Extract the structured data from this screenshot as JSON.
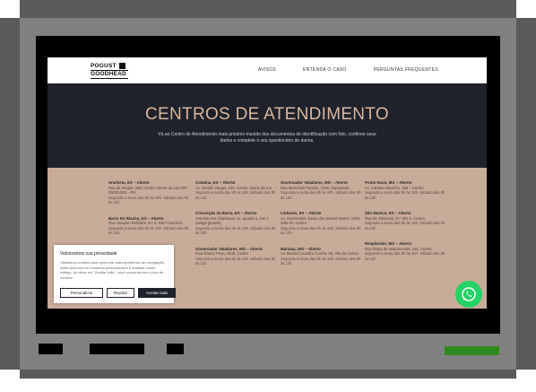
{
  "logo": {
    "line1": "POGUST",
    "line2": "GOODHEAD"
  },
  "nav": {
    "links": [
      "AVISOS",
      "ENTENDA O CASO",
      "PERGUNTAS FREQUENTES"
    ]
  },
  "hero": {
    "title": "CENTROS DE ATENDIMENTO",
    "subtitle": "Vá ao Centro de Atendimento mais próximo munido dos documentos de identificação com foto, confirme seus dados e complete o seu questionário de danos."
  },
  "centers": {
    "col1": [
      {
        "city": "Anchieta, ES – Aberto",
        "addr": "Rua da Alegria, 285, Centro, Nome da rua CEP 29230-000 – ES",
        "hours": "Segunda a sexta das 8h às 18h. Sábado das 8h às 12h"
      },
      {
        "city": "Barra Do Riacho, ES – Aberto",
        "addr": "Rua Joaquim Belizário, N.º 0, São Francisco",
        "hours": "Segunda a sexta das 8h às 18h. Sábado das 8h às 12h"
      }
    ],
    "col2": [
      {
        "city": "Colatina, ES – Aberto",
        "addr": "Av. Getúlio Vargas, 230, Centro, Nome da rua",
        "hours": "Segunda a sexta das 8h às 18h. Sábado das 8h às 12h"
      },
      {
        "city": "Conceição da Barra, ES – Aberto",
        "addr": "Avenida Ana Charleaux, 11, quadra 1, lote 1 (antigo ginásio)",
        "hours": "Segunda a sexta das 8h às 18h. Sábado das 8h às 12h"
      },
      {
        "city": "Governador Valadares, MG – Aberto",
        "addr": "Rua Afonso Pena, 2540, Centro",
        "hours": "Segunda a sexta das 8h às 18h. Sábado das 8h às 12h"
      }
    ],
    "col3": [
      {
        "city": "Governador Valadares, MG – Aberto",
        "addr": "Rua Marechal Floriano, 1055, Esplanada",
        "hours": "Segunda a sexta das 8h às 18h. Sábado das 8h às 12h"
      },
      {
        "city": "Linhares, ES – Aberto",
        "addr": "Av. Governador Jones dos Santos Neves, 1000, Sala 01, Centro",
        "hours": "Segunda a sexta das 8h às 18h. Sábado das 8h às 12h"
      },
      {
        "city": "Mariana, MG – Aberto",
        "addr": "Av. Manoel Leandro Corrêa, 49, Vila do Carmo",
        "hours": "Segunda a sexta das 8h às 18h. Sábado das 8h às 12h"
      }
    ],
    "col4": [
      {
        "city": "Ponte Nova, MG – Aberto",
        "addr": "Av. Caetano Marinho, 102 – Centro",
        "hours": "Segunda a sexta das 8h às 18h. Sábado das 8h às 12h"
      },
      {
        "city": "São Mateus, ES – Aberto",
        "addr": "Rua Dr. Moscoso, N.º 281 A, Centro",
        "hours": "Segunda a sexta das 8h às 18h. Sábado das 8h às 12h"
      },
      {
        "city": "Resplendor, MG – Aberto",
        "addr": "Rua Diogo de Vasconcelos, 143, Centro",
        "hours": "Segunda a sexta das 8h às 18h. Sábado das 8h às 12h"
      }
    ]
  },
  "cookie": {
    "title": "Valorizamos sua privacidade",
    "text": "Utilizamos cookies para aprimorar sua experiência de navegação, exibir anúncios ou conteúdo personalizado e analisar nosso tráfego. Ao clicar em \"Aceitar tudo\", você concorda com o uso de cookies.",
    "btn_customize": "Personalizar",
    "btn_reject": "Rejeitar",
    "btn_accept": "Aceitar tudo"
  },
  "colors": {
    "hero_bg": "#1f222b",
    "hero_title": "#d9b79c",
    "centers_bg": "#c8ab98",
    "whatsapp": "#25d366",
    "taskbar_green": "#2f8a1d"
  },
  "icons": {
    "whatsapp": "whatsapp-icon"
  }
}
